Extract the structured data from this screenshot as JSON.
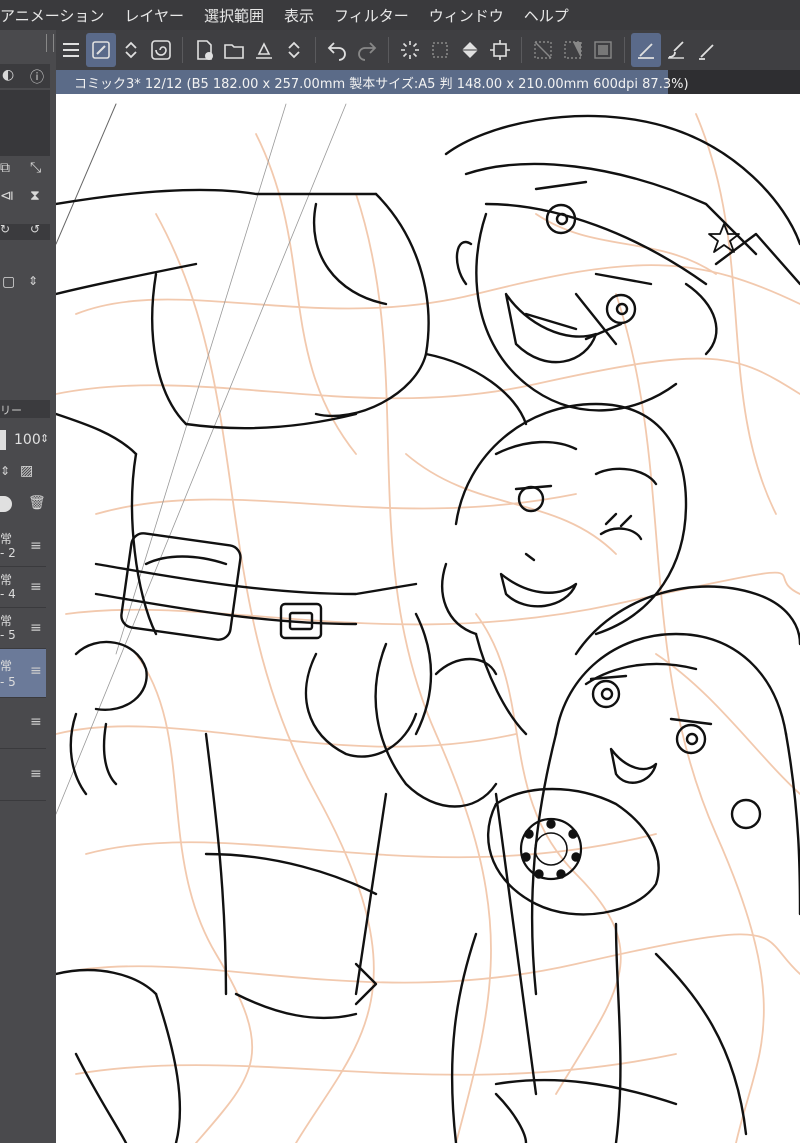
{
  "menu": {
    "items": [
      "アニメーション",
      "レイヤー",
      "選択範囲",
      "表示",
      "フィルター",
      "ウィンドウ",
      "ヘルプ"
    ]
  },
  "toolbar": {
    "icons": [
      "menu-icon",
      "brush-tool-icon",
      "stepper-icon",
      "spiral-icon",
      "new-page-icon",
      "open-folder-icon",
      "export-icon",
      "stepper-icon",
      "undo-icon",
      "redo-icon",
      "loading-icon",
      "transform-icon",
      "fill-icon",
      "crop-icon",
      "deselect-icon",
      "invert-selection-icon",
      "frame-icon",
      "pen-pressure-icon",
      "brush-size-icon",
      "more-icon"
    ]
  },
  "document_tab": {
    "title": "コミック3* 12/12 (B5 182.00 x 257.00mm 製本サイズ:A5 判 148.00 x 210.00mm 600dpi 87.3%)"
  },
  "left_panel": {
    "section_label": "リー",
    "opacity_value": "100",
    "layers": [
      {
        "line1": "常",
        "line2": "- 2"
      },
      {
        "line1": "常",
        "line2": "- 4"
      },
      {
        "line1": "常",
        "line2": "- 5"
      },
      {
        "line1": "常",
        "line2": "- 5"
      }
    ]
  },
  "colors": {
    "menubar_bg": "#3a3a3d",
    "toolbar_bg": "#3f3f42",
    "tab_active": "#5b6b88",
    "panel_bg": "#4a4a4d",
    "layer_selected": "#6b7a99",
    "sketch_lines": "#f2c9ae",
    "ink_lines": "#111111"
  }
}
